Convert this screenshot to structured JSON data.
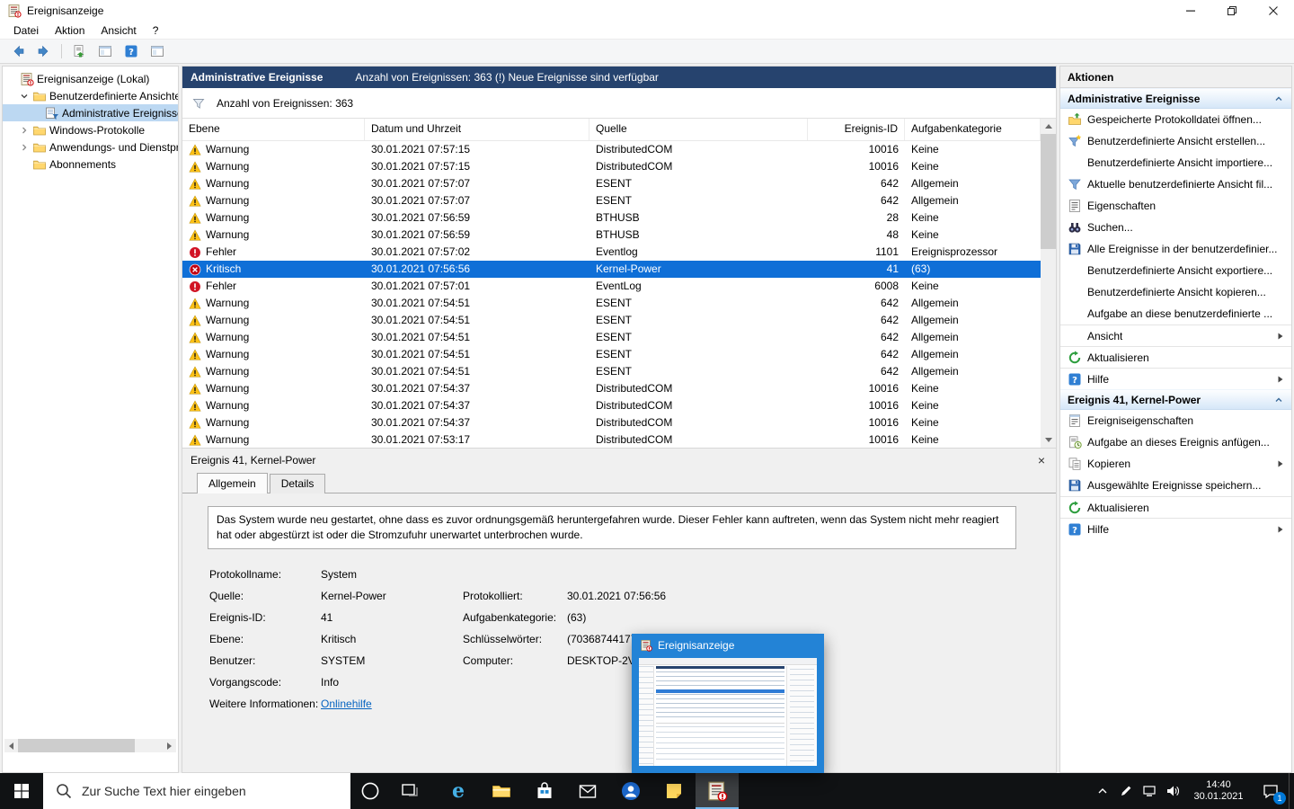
{
  "colors": {
    "accent": "#0078d7",
    "selection_blue": "#0f6fd7",
    "header_navy": "#26436e",
    "taskbar_dark": "#101214",
    "warning_yellow": "#fdc116",
    "error_red": "#d11324"
  },
  "window": {
    "title": "Ereignisanzeige",
    "menu": [
      "Datei",
      "Aktion",
      "Ansicht",
      "?"
    ],
    "toolbar": [
      "back-icon",
      "forward-icon",
      "|",
      "export-doc-icon",
      "console-window-icon",
      "help-icon",
      "console-window-icon"
    ]
  },
  "tree": {
    "items": [
      {
        "label": "Ereignisanzeige (Lokal)",
        "indent": 0,
        "icon": "event-viewer-icon",
        "chevron": "none",
        "selected": false
      },
      {
        "label": "Benutzerdefinierte Ansichten",
        "indent": 1,
        "icon": "folder-icon",
        "chevron": "expanded",
        "selected": false
      },
      {
        "label": "Administrative Ereignisse",
        "indent": 2,
        "icon": "custom-view-icon",
        "chevron": "none",
        "selected": true
      },
      {
        "label": "Windows-Protokolle",
        "indent": 1,
        "icon": "folder-icon",
        "chevron": "collapsed",
        "selected": false
      },
      {
        "label": "Anwendungs- und Dienstpro",
        "indent": 1,
        "icon": "folder-icon",
        "chevron": "collapsed",
        "selected": false
      },
      {
        "label": "Abonnements",
        "indent": 1,
        "icon": "folder-icon",
        "chevron": "none",
        "selected": false
      }
    ]
  },
  "main": {
    "title": "Administrative Ereignisse",
    "subtitle": "Anzahl von Ereignissen: 363 (!) Neue Ereignisse sind verfügbar",
    "filter_text": "Anzahl von Ereignissen: 363",
    "columns": [
      "Ebene",
      "Datum und Uhrzeit",
      "Quelle",
      "Ereignis-ID",
      "Aufgabenkategorie"
    ],
    "rows": [
      {
        "level": "warning",
        "level_label": "Warnung",
        "datetime": "30.01.2021 07:57:15",
        "source": "DistributedCOM",
        "event_id": "10016",
        "category": "Keine",
        "selected": false
      },
      {
        "level": "warning",
        "level_label": "Warnung",
        "datetime": "30.01.2021 07:57:15",
        "source": "DistributedCOM",
        "event_id": "10016",
        "category": "Keine",
        "selected": false
      },
      {
        "level": "warning",
        "level_label": "Warnung",
        "datetime": "30.01.2021 07:57:07",
        "source": "ESENT",
        "event_id": "642",
        "category": "Allgemein",
        "selected": false
      },
      {
        "level": "warning",
        "level_label": "Warnung",
        "datetime": "30.01.2021 07:57:07",
        "source": "ESENT",
        "event_id": "642",
        "category": "Allgemein",
        "selected": false
      },
      {
        "level": "warning",
        "level_label": "Warnung",
        "datetime": "30.01.2021 07:56:59",
        "source": "BTHUSB",
        "event_id": "28",
        "category": "Keine",
        "selected": false
      },
      {
        "level": "warning",
        "level_label": "Warnung",
        "datetime": "30.01.2021 07:56:59",
        "source": "BTHUSB",
        "event_id": "48",
        "category": "Keine",
        "selected": false
      },
      {
        "level": "error",
        "level_label": "Fehler",
        "datetime": "30.01.2021 07:57:02",
        "source": "Eventlog",
        "event_id": "1101",
        "category": "Ereignisprozessor",
        "selected": false
      },
      {
        "level": "critical",
        "level_label": "Kritisch",
        "datetime": "30.01.2021 07:56:56",
        "source": "Kernel-Power",
        "event_id": "41",
        "category": "(63)",
        "selected": true
      },
      {
        "level": "error",
        "level_label": "Fehler",
        "datetime": "30.01.2021 07:57:01",
        "source": "EventLog",
        "event_id": "6008",
        "category": "Keine",
        "selected": false
      },
      {
        "level": "warning",
        "level_label": "Warnung",
        "datetime": "30.01.2021 07:54:51",
        "source": "ESENT",
        "event_id": "642",
        "category": "Allgemein",
        "selected": false
      },
      {
        "level": "warning",
        "level_label": "Warnung",
        "datetime": "30.01.2021 07:54:51",
        "source": "ESENT",
        "event_id": "642",
        "category": "Allgemein",
        "selected": false
      },
      {
        "level": "warning",
        "level_label": "Warnung",
        "datetime": "30.01.2021 07:54:51",
        "source": "ESENT",
        "event_id": "642",
        "category": "Allgemein",
        "selected": false
      },
      {
        "level": "warning",
        "level_label": "Warnung",
        "datetime": "30.01.2021 07:54:51",
        "source": "ESENT",
        "event_id": "642",
        "category": "Allgemein",
        "selected": false
      },
      {
        "level": "warning",
        "level_label": "Warnung",
        "datetime": "30.01.2021 07:54:51",
        "source": "ESENT",
        "event_id": "642",
        "category": "Allgemein",
        "selected": false
      },
      {
        "level": "warning",
        "level_label": "Warnung",
        "datetime": "30.01.2021 07:54:37",
        "source": "DistributedCOM",
        "event_id": "10016",
        "category": "Keine",
        "selected": false
      },
      {
        "level": "warning",
        "level_label": "Warnung",
        "datetime": "30.01.2021 07:54:37",
        "source": "DistributedCOM",
        "event_id": "10016",
        "category": "Keine",
        "selected": false
      },
      {
        "level": "warning",
        "level_label": "Warnung",
        "datetime": "30.01.2021 07:54:37",
        "source": "DistributedCOM",
        "event_id": "10016",
        "category": "Keine",
        "selected": false
      },
      {
        "level": "warning",
        "level_label": "Warnung",
        "datetime": "30.01.2021 07:53:17",
        "source": "DistributedCOM",
        "event_id": "10016",
        "category": "Keine",
        "selected": false
      }
    ]
  },
  "details": {
    "title": "Ereignis 41, Kernel-Power",
    "close_glyph": "×",
    "tabs": [
      {
        "label": "Allgemein",
        "active": true
      },
      {
        "label": "Details",
        "active": false
      }
    ],
    "description": "Das System wurde neu gestartet, ohne dass es zuvor ordnungsgemäß heruntergefahren wurde. Dieser Fehler kann auftreten, wenn das System nicht mehr reagiert hat oder abgestürzt ist oder die Stromzufuhr unerwartet unterbrochen wurde.",
    "fields": [
      {
        "label1": "Protokollname:",
        "value1": "System",
        "label2": "",
        "value2": ""
      },
      {
        "label1": "Quelle:",
        "value1": "Kernel-Power",
        "label2": "Protokolliert:",
        "value2": "30.01.2021 07:56:56"
      },
      {
        "label1": "Ereignis-ID:",
        "value1": "41",
        "label2": "Aufgabenkategorie:",
        "value2": "(63)"
      },
      {
        "label1": "Ebene:",
        "value1": "Kritisch",
        "label2": "Schlüsselwörter:",
        "value2": "(70368744177664),(2)"
      },
      {
        "label1": "Benutzer:",
        "value1": "SYSTEM",
        "label2": "Computer:",
        "value2": "DESKTOP-2VG"
      },
      {
        "label1": "Vorgangscode:",
        "value1": "Info",
        "label2": "",
        "value2": ""
      },
      {
        "label1": "Weitere Informationen:",
        "value1": "Onlinehilfe",
        "link": true,
        "label2": "",
        "value2": ""
      }
    ]
  },
  "actions": {
    "panel_title": "Aktionen",
    "sections": [
      {
        "title": "Administrative Ereignisse",
        "items": [
          {
            "label": "Gespeicherte Protokolldatei öffnen...",
            "icon": "open-log-icon"
          },
          {
            "label": "Benutzerdefinierte Ansicht erstellen...",
            "icon": "create-view-icon"
          },
          {
            "label": "Benutzerdefinierte Ansicht importiere...",
            "icon": ""
          },
          {
            "label": "Aktuelle benutzerdefinierte Ansicht fil...",
            "icon": "filter-icon"
          },
          {
            "label": "Eigenschaften",
            "icon": "properties-icon"
          },
          {
            "label": "Suchen...",
            "icon": "search-icon"
          },
          {
            "label": "Alle Ereignisse in der benutzerdefinier...",
            "icon": "save-icon"
          },
          {
            "label": "Benutzerdefinierte Ansicht exportiere...",
            "icon": ""
          },
          {
            "label": "Benutzerdefinierte Ansicht kopieren...",
            "icon": ""
          },
          {
            "label": "Aufgabe an diese benutzerdefinierte ...",
            "icon": ""
          },
          {
            "label": "Ansicht",
            "icon": "",
            "submenu": true,
            "sep": true
          },
          {
            "label": "Aktualisieren",
            "icon": "refresh-icon",
            "sep": true
          },
          {
            "label": "Hilfe",
            "icon": "help-icon",
            "submenu": true,
            "sep": true
          }
        ]
      },
      {
        "title": "Ereignis 41, Kernel-Power",
        "items": [
          {
            "label": "Ereigniseigenschaften",
            "icon": "event-properties-icon"
          },
          {
            "label": "Aufgabe an dieses Ereignis anfügen...",
            "icon": "attach-task-icon"
          },
          {
            "label": "Kopieren",
            "icon": "copy-icon",
            "submenu": true
          },
          {
            "label": "Ausgewählte Ereignisse speichern...",
            "icon": "save-icon"
          },
          {
            "label": "Aktualisieren",
            "icon": "refresh-icon",
            "sep": true
          },
          {
            "label": "Hilfe",
            "icon": "help-icon",
            "submenu": true,
            "sep": true
          }
        ]
      }
    ]
  },
  "preview": {
    "title": "Ereignisanzeige"
  },
  "taskbar": {
    "search_placeholder": "Zur Suche Text hier eingeben",
    "apps": [
      {
        "name": "edge",
        "active": false
      },
      {
        "name": "explorer",
        "active": false
      },
      {
        "name": "store",
        "active": false
      },
      {
        "name": "mail",
        "active": false
      },
      {
        "name": "people",
        "active": false
      },
      {
        "name": "sticky-notes",
        "active": false
      },
      {
        "name": "event-viewer",
        "active": true
      }
    ],
    "tray_icons": [
      "chevron-up-icon",
      "pen-icon",
      "network-icon",
      "volume-icon"
    ],
    "clock": {
      "time": "14:40",
      "date": "30.01.2021"
    },
    "notification_badge": "1"
  }
}
